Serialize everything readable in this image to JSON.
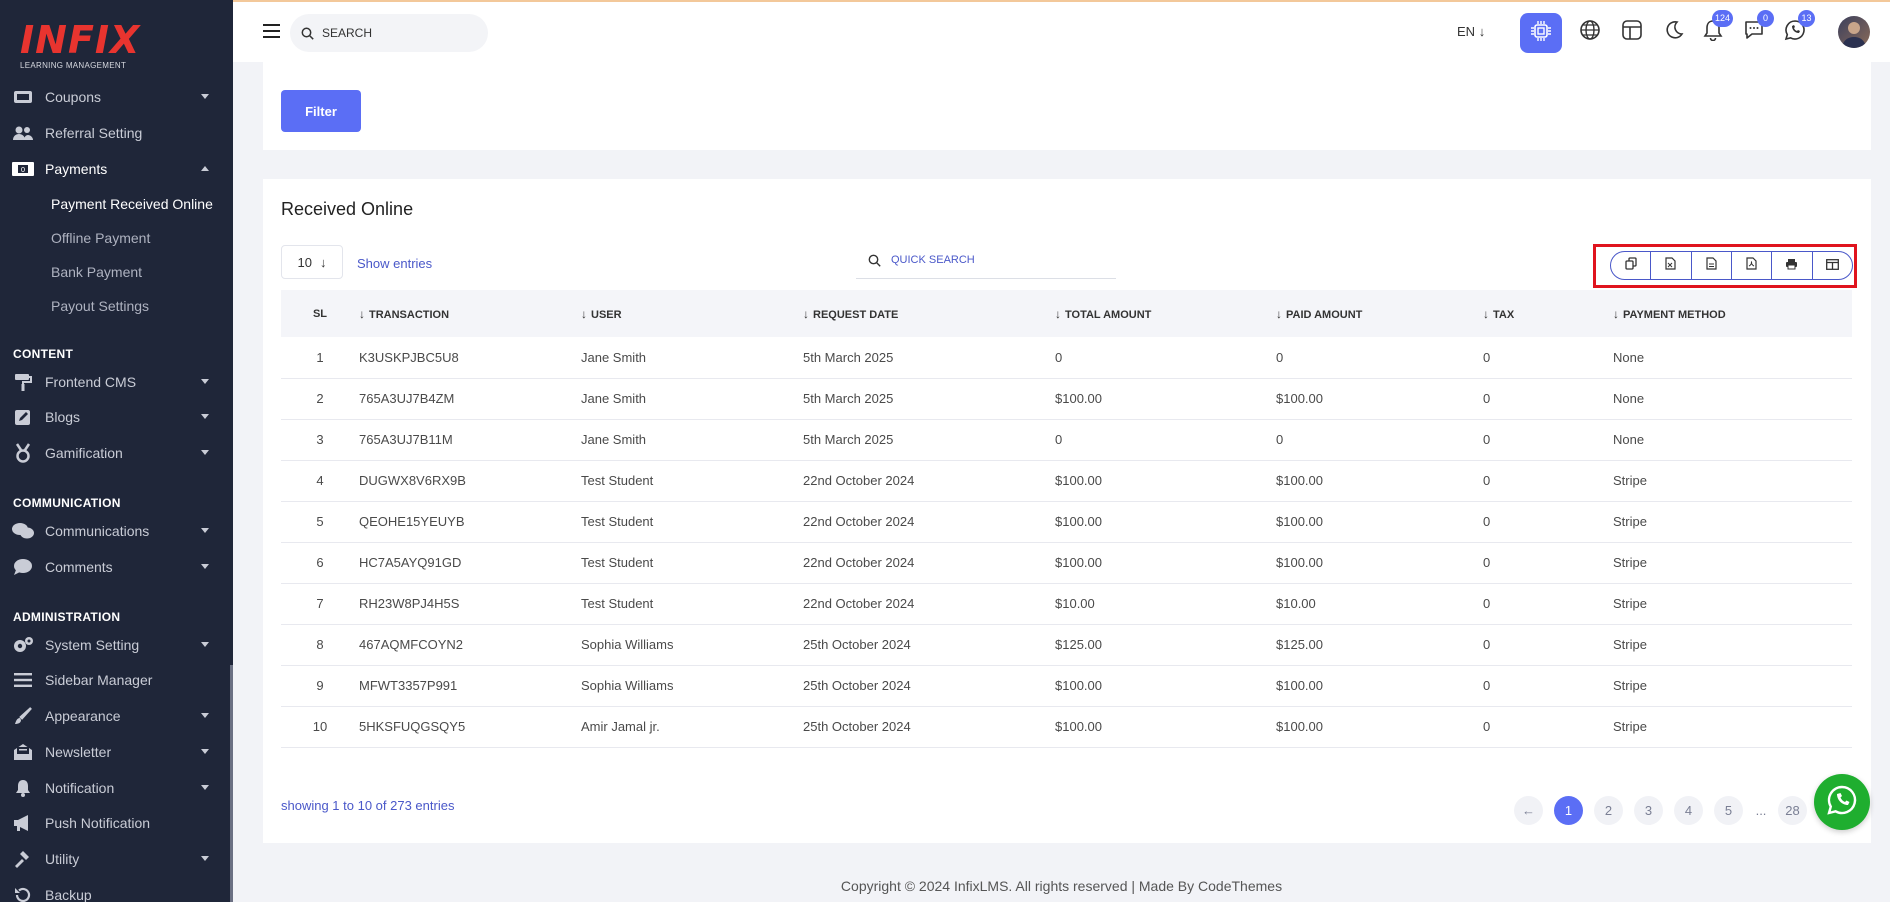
{
  "brand": {
    "logo_text": "INFIX",
    "logo_sub": "LEARNING MANAGEMENT"
  },
  "sidebar": {
    "items": [
      {
        "label": "Coupons"
      },
      {
        "label": "Referral Setting"
      },
      {
        "label": "Payments"
      },
      {
        "label": "Frontend CMS"
      },
      {
        "label": "Blogs"
      },
      {
        "label": "Gamification"
      },
      {
        "label": "Communications"
      },
      {
        "label": "Comments"
      },
      {
        "label": "System Setting"
      },
      {
        "label": "Sidebar Manager"
      },
      {
        "label": "Appearance"
      },
      {
        "label": "Newsletter"
      },
      {
        "label": "Notification"
      },
      {
        "label": "Push Notification"
      },
      {
        "label": "Utility"
      },
      {
        "label": "Backup"
      }
    ],
    "subitems": [
      {
        "label": "Payment Received Online"
      },
      {
        "label": "Offline Payment"
      },
      {
        "label": "Bank Payment"
      },
      {
        "label": "Payout Settings"
      }
    ],
    "headings": {
      "content": "CONTENT",
      "communication": "COMMUNICATION",
      "administration": "ADMINISTRATION"
    }
  },
  "header": {
    "search_placeholder": "SEARCH",
    "language": "EN",
    "badges": {
      "notifications": "124",
      "messages": "0",
      "whatsapp": "13"
    }
  },
  "filter": {
    "button_label": "Filter"
  },
  "table_card": {
    "title": "Received Online",
    "entries_value": "10",
    "show_entries_label": "Show entries",
    "quick_search_placeholder": "QUICK SEARCH",
    "columns": [
      "SL",
      "TRANSACTION",
      "USER",
      "REQUEST DATE",
      "TOTAL AMOUNT",
      "PAID AMOUNT",
      "TAX",
      "PAYMENT METHOD"
    ],
    "rows": [
      [
        "1",
        "K3USKPJBC5U8",
        "Jane Smith",
        "5th March 2025",
        "0",
        "0",
        "0",
        "None"
      ],
      [
        "2",
        "765A3UJ7B4ZM",
        "Jane Smith",
        "5th March 2025",
        "$100.00",
        "$100.00",
        "0",
        "None"
      ],
      [
        "3",
        "765A3UJ7B11M",
        "Jane Smith",
        "5th March 2025",
        "0",
        "0",
        "0",
        "None"
      ],
      [
        "4",
        "DUGWX8V6RX9B",
        "Test Student",
        "22nd October 2024",
        "$100.00",
        "$100.00",
        "0",
        "Stripe"
      ],
      [
        "5",
        "QEOHE15YEUYB",
        "Test Student",
        "22nd October 2024",
        "$100.00",
        "$100.00",
        "0",
        "Stripe"
      ],
      [
        "6",
        "HC7A5AYQ91GD",
        "Test Student",
        "22nd October 2024",
        "$100.00",
        "$100.00",
        "0",
        "Stripe"
      ],
      [
        "7",
        "RH23W8PJ4H5S",
        "Test Student",
        "22nd October 2024",
        "$10.00",
        "$10.00",
        "0",
        "Stripe"
      ],
      [
        "8",
        "467AQMFCOYN2",
        "Sophia Williams",
        "25th October 2024",
        "$125.00",
        "$125.00",
        "0",
        "Stripe"
      ],
      [
        "9",
        "MFWT3357P991",
        "Sophia Williams",
        "25th October 2024",
        "$100.00",
        "$100.00",
        "0",
        "Stripe"
      ],
      [
        "10",
        "5HKSFUQGSQY5",
        "Amir Jamal jr.",
        "25th October 2024",
        "$100.00",
        "$100.00",
        "0",
        "Stripe"
      ]
    ],
    "showing_text": "showing 1 to 10 of 273 entries",
    "pages": [
      "1",
      "2",
      "3",
      "4",
      "5",
      "...",
      "28"
    ]
  },
  "footer": {
    "copyright": "Copyright © 2024 InfixLMS. All rights reserved | Made By CodeThemes"
  },
  "colors": {
    "accent": "#5b6ef5",
    "sidebar_bg": "#1f2639",
    "highlight": "#e0141e",
    "whatsapp": "#1fae2f"
  }
}
